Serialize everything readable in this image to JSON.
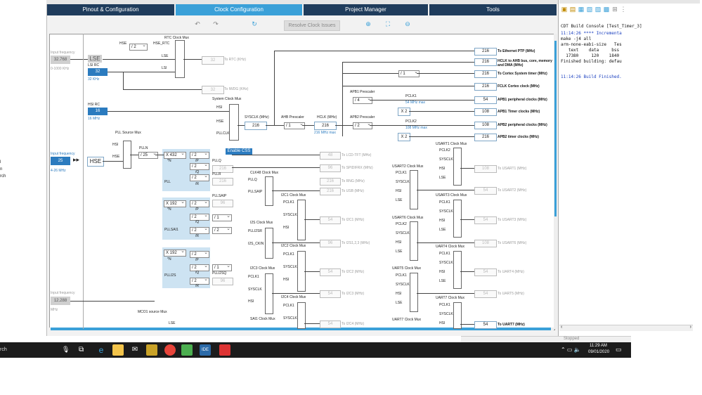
{
  "left_panel": {
    "labels": [
      "l",
      "n",
      "rch"
    ]
  },
  "tabs": [
    {
      "label": "Pinout & Configuration",
      "active": false
    },
    {
      "label": "Clock Configuration",
      "active": true
    },
    {
      "label": "Project Manager",
      "active": false
    },
    {
      "label": "Tools",
      "active": false
    }
  ],
  "toolbar": {
    "resolve_label": "Resolve Clock Issues"
  },
  "inputs": {
    "lse_freq_label": "Input frequency",
    "lse_freq": "32.768",
    "lse_range": "0-1000 KHz",
    "lse": "LSE",
    "lsi_rc": "LSI RC",
    "lsi_val": "32",
    "lsi_unit": "32 KHz",
    "hsi_rc": "HSI RC",
    "hsi_val": "16",
    "hsi_unit": "16 MHz",
    "hse_freq_label": "Input frequency",
    "hse_freq": "25",
    "hse_range": "4-26 MHz",
    "hse": "HSE",
    "ext_freq_label": "Input frequency",
    "ext_freq": "12.288",
    "ext_unit": "MHz"
  },
  "rtc": {
    "title": "RTC Clock Mux",
    "hse": "HSE",
    "div": "/ 2",
    "hse_rtc": "HSE_RTC",
    "lse": "LSE",
    "lsi": "LSI",
    "value": "32",
    "to": "To RTC (KHz)",
    "iwdg_value": "32",
    "iwdg_to": "To IWDG (KHz)"
  },
  "sysclk": {
    "mux_title": "System Clock Mux",
    "hsi": "HSI",
    "hse": "HSE",
    "pllclk": "PLLCLK",
    "label": "SYSCLK (MHz)",
    "value": "216",
    "enable_css": "Enable CSS"
  },
  "ahb": {
    "label": "AHB Prescaler",
    "div": "/ 1",
    "hclk_label": "HCLK (MHz)",
    "hclk": "216",
    "hclk_max": "216 MHz max"
  },
  "apb1": {
    "label": "APB1 Prescaler",
    "div": "/ 4",
    "pclk": "PCLK1",
    "pclk_max": "54 MHz max",
    "x2": "X 2"
  },
  "apb2": {
    "label": "APB2 Prescaler",
    "div": "/ 2",
    "pclk": "PCLK2",
    "pclk_max": "108 MHz max",
    "x2": "X 2"
  },
  "cortex_div": "/ 1",
  "outputs": [
    {
      "value": "216",
      "label": "To Ethernet PTP (MHz)"
    },
    {
      "value": "216",
      "label": "HCLK to AHB bus, core, memory and DMA (MHz)"
    },
    {
      "value": "216",
      "label": "To Cortex System timer (MHz)"
    },
    {
      "value": "216",
      "label": "FCLK Cortex clock (MHz)"
    },
    {
      "value": "54",
      "label": "APB1 peripheral clocks (MHz)"
    },
    {
      "value": "108",
      "label": "APB1 Timer clocks (MHz)"
    },
    {
      "value": "108",
      "label": "APB2 peripheral clocks (MHz)"
    },
    {
      "value": "216",
      "label": "APB2 timer clocks (MHz)"
    }
  ],
  "pll": {
    "source_mux": "PLL Source Mux",
    "hsi": "HSI",
    "hse": "HSE",
    "plln_label": "PLLN",
    "pllm": "/ 25",
    "plln": "X 432",
    "n": "*N",
    "p_div": "/ 2",
    "p": "/P",
    "q_div": "/ 2",
    "q": "/Q",
    "r_div": "/ 2",
    "r": "/R",
    "name": "PLL",
    "pllq": "PLLQ",
    "pllr": "PLLR",
    "q_val": "216",
    "r_val": "216"
  },
  "pllsai": {
    "n_mul": "X 192",
    "n": "*N",
    "p_div": "/ 2",
    "p": "/P",
    "q_div": "/ 2",
    "q": "/Q",
    "r_div": "/ 2",
    "r": "/R",
    "name": "PLLSAI1",
    "pllsaip": "PLLSAIP",
    "p_val": "96",
    "extra_div1": "/ 1",
    "extra_div2": "/ 2"
  },
  "plli2s": {
    "n_mul": "X 192",
    "n": "*N",
    "p_div": "/ 2",
    "p": "/P",
    "q_div": "/ 2",
    "q": "/Q",
    "r_div": "/ 2",
    "r": "/R",
    "name": "PLLI2S",
    "plli2sq": "PLLI2SQ",
    "extra_div": "/ 1",
    "q_val": "96"
  },
  "mid_outputs": [
    {
      "value": "48",
      "label": "To LCD-TFT (MHz)"
    },
    {
      "value": "96",
      "label": "To SPIDIFRX (MHz)"
    },
    {
      "value": "216",
      "label": "To RNG (MHz)"
    },
    {
      "value": "216",
      "label": "To USB (MHz)"
    },
    {
      "value": "54",
      "label": "To I2C1 (MHz)"
    },
    {
      "value": "96",
      "label": "To I2S1,2,3 (MHz)"
    },
    {
      "value": "54",
      "label": "To I2C2 (MHz)"
    },
    {
      "value": "54",
      "label": "To I2C3 (MHz)"
    },
    {
      "value": "54",
      "label": "To I2C4 (MHz)"
    }
  ],
  "mid_muxes": {
    "clk48": "CLK48 Clock Mux",
    "pllq": "PLLQ",
    "pllsaip": "PLLSAIP",
    "i2c1": "I2C1 Clock Mux",
    "i2s": "I2S Clock Mux",
    "plli2sr": "PLLI2SR",
    "i2s_ckin": "I2S_CKIN",
    "i2c2": "I2C2 Clock Mux",
    "i2c3": "I2C3 Clock Mux",
    "i2c4": "I2C4 Clock Mux",
    "sai1": "SAI1 Clock Mux",
    "pclk1": "PCLK1",
    "sysclk": "SYSCLK",
    "hsi": "HSI",
    "mco1": "MCO1 source Mux",
    "lse": "LSE"
  },
  "usart_outputs": [
    {
      "mux": "USART1 Clock Mux",
      "value": "108",
      "label": "To USART1 (MHz)"
    },
    {
      "mux": "USART2 Clock Mux",
      "value": "54",
      "label": "To USART2 (MHz)"
    },
    {
      "mux": "USART3 Clock Mux",
      "value": "54",
      "label": "To USART3 (MHz)"
    },
    {
      "mux": "USART6 Clock Mux",
      "value": "108",
      "label": "To USART6 (MHz)"
    },
    {
      "mux": "UART4 Clock Mux",
      "value": "54",
      "label": "To UART4 (MHz)"
    },
    {
      "mux": "UART5 Clock Mux",
      "value": "54",
      "label": "To UART5 (MHz)"
    },
    {
      "mux": "UART7 Clock Mux",
      "value": "54",
      "label": "To UART7 (MHz)"
    }
  ],
  "usart_inputs": {
    "pclk2": "PCLK2",
    "pclk1": "PCLK1",
    "sysclk": "SYSCLK",
    "hsi": "HSI",
    "lse": "LSE"
  },
  "right_panel": {
    "title": "CDT Build Console [Test_Timer_3]",
    "lines": [
      "11:14:26 **** Incrementa",
      "make -j4 all",
      "arm-none-eabi-size   Tes",
      "   text    data     bss",
      "  17380     120    1840",
      "Finished building: defau",
      "",
      "11:14:26 Build Finished."
    ]
  },
  "statusbar": {
    "stopped": "Stopped"
  },
  "taskbar": {
    "search": "rch",
    "time": "11:29 AM",
    "date": "09/01/2020",
    "ide_label": "IDE"
  }
}
